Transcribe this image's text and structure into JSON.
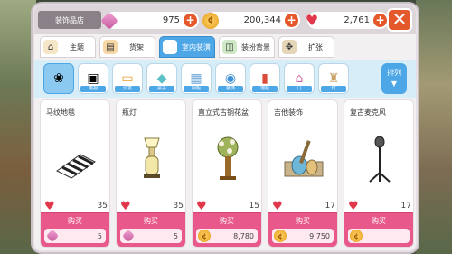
{
  "header": {
    "shop_label": "装饰品店",
    "gems": "975",
    "coins": "200,344",
    "hearts": "2,761",
    "close_label": "✕"
  },
  "tabs": [
    {
      "label": "主题",
      "icon": "house-icon"
    },
    {
      "label": "货架",
      "icon": "shelf-icon"
    },
    {
      "label": "室内装潢",
      "icon": "sofa-icon"
    },
    {
      "label": "装扮背景",
      "icon": "wallpaper-icon"
    },
    {
      "label": "扩张",
      "icon": "expand-icon"
    }
  ],
  "categories": [
    {
      "label": "盆栽"
    },
    {
      "label": "电视"
    },
    {
      "label": "沙发"
    },
    {
      "label": "桌子"
    },
    {
      "label": "橱柜"
    },
    {
      "label": "装饰"
    },
    {
      "label": "地毯"
    },
    {
      "label": "门"
    },
    {
      "label": "灯"
    }
  ],
  "sort": {
    "label": "排列",
    "arrow": "▼"
  },
  "items": [
    {
      "name": "马纹地毯",
      "likes": "35",
      "buy_label": "购买",
      "price": "5",
      "currency": "gem"
    },
    {
      "name": "瓶灯",
      "likes": "35",
      "buy_label": "购买",
      "price": "5",
      "currency": "gem"
    },
    {
      "name": "直立式古铜花盆",
      "likes": "15",
      "buy_label": "购买",
      "price": "8,780",
      "currency": "coin"
    },
    {
      "name": "吉他装饰",
      "likes": "17",
      "buy_label": "购买",
      "price": "9,750",
      "currency": "coin"
    },
    {
      "name": "复古麦克风",
      "likes": "17",
      "buy_label": "购买",
      "price": "",
      "currency": "coin"
    }
  ],
  "colors": {
    "accent_blue": "#4da6e6",
    "buy_pink": "#e8588a",
    "close_orange": "#e5582b",
    "heart_red": "#e0374b"
  }
}
